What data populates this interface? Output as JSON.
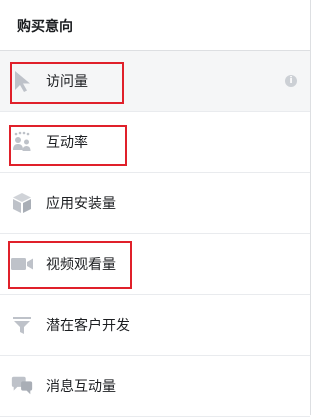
{
  "section_title": "购买意向",
  "items": [
    {
      "label": "访问量",
      "icon": "cursor-icon",
      "selected": true,
      "info": "i"
    },
    {
      "label": "互动率",
      "icon": "people-icon"
    },
    {
      "label": "应用安装量",
      "icon": "cube-icon"
    },
    {
      "label": "视频观看量",
      "icon": "video-camera-icon"
    },
    {
      "label": "潜在客户开发",
      "icon": "funnel-icon"
    },
    {
      "label": "消息互动量",
      "icon": "chat-bubbles-icon"
    }
  ],
  "colors": {
    "icon": "#bec2c9",
    "highlight": "#e0202a",
    "selected_bg": "#f5f6f7"
  }
}
